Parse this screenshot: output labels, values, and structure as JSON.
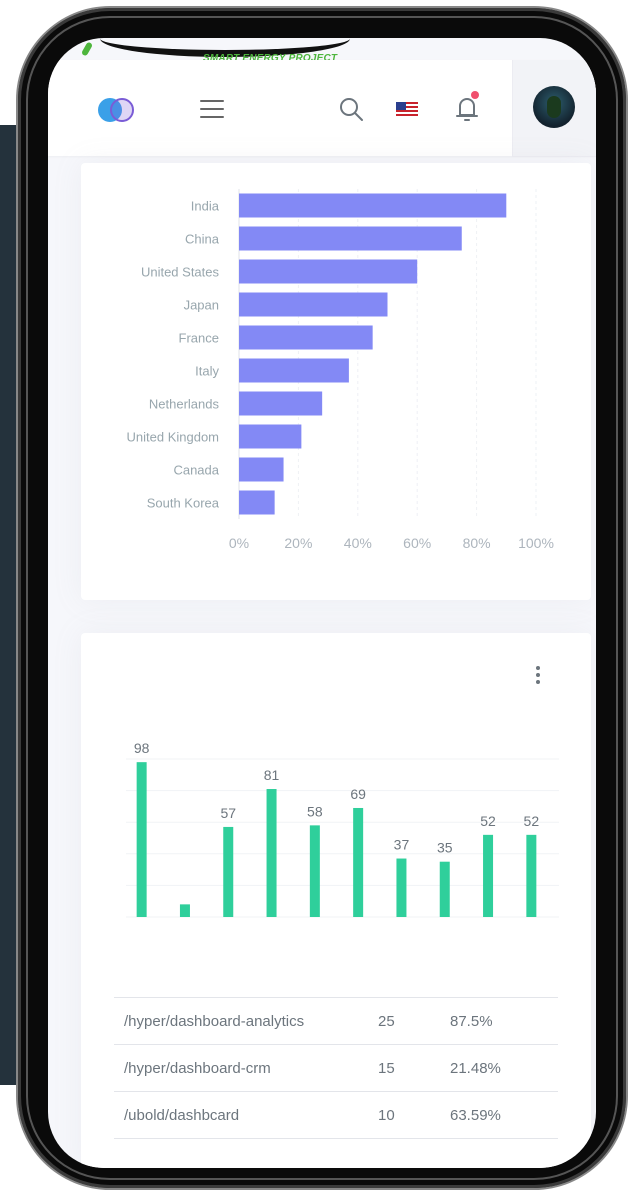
{
  "brand": {
    "tagline": "SMART ENERGY PROJECT",
    "color": "#4db53c"
  },
  "header": {
    "icons": [
      "app-logo",
      "menu-icon",
      "search-icon",
      "us-flag-icon",
      "bell-icon",
      "avatar"
    ],
    "notification_dot_color": "#f0506e"
  },
  "country_chart": {
    "chart_data": {
      "type": "bar",
      "orientation": "horizontal",
      "categories": [
        "India",
        "China",
        "United States",
        "Japan",
        "France",
        "Italy",
        "Netherlands",
        "United Kingdom",
        "Canada",
        "South Korea"
      ],
      "values": [
        90,
        75,
        60,
        50,
        45,
        37,
        28,
        21,
        15,
        12
      ],
      "x_unit": "%",
      "xlim": [
        0,
        100
      ],
      "x_ticks": [
        "0%",
        "20%",
        "40%",
        "60%",
        "80%",
        "100%"
      ],
      "color": "#8389f5",
      "grid": true
    }
  },
  "sessions_chart": {
    "chart_data": {
      "type": "bar",
      "values": [
        98,
        8,
        57,
        81,
        58,
        69,
        37,
        35,
        52,
        52
      ],
      "data_labels": [
        "98",
        "",
        "57",
        "81",
        "58",
        "69",
        "37",
        "35",
        "52",
        "52"
      ],
      "ylim": [
        0,
        100
      ],
      "color": "#2fcf9b",
      "grid": true
    }
  },
  "pages_table": {
    "rows": [
      {
        "page": "/hyper/dashboard-analytics",
        "views": "25",
        "rate": "87.5%"
      },
      {
        "page": "/hyper/dashboard-crm",
        "views": "15",
        "rate": "21.48%"
      },
      {
        "page": "/ubold/dashbcard",
        "views": "10",
        "rate": "63.59%"
      }
    ]
  }
}
